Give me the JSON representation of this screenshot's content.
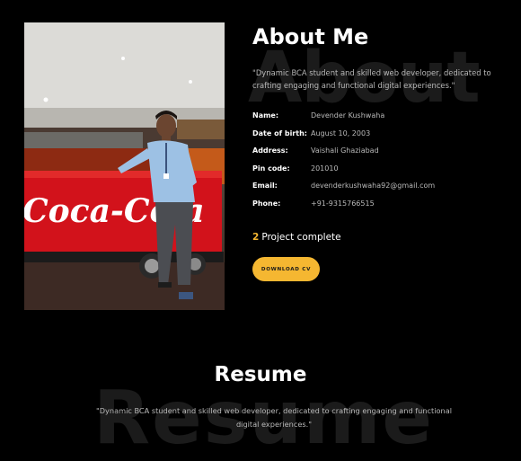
{
  "about": {
    "bg_text": "About",
    "title": "About Me",
    "description": "\"Dynamic BCA student and skilled web developer, dedicated to crafting engaging and functional digital experiences.\"",
    "photo_brand_text": "Coca-Cola",
    "info": [
      {
        "label": "Name:",
        "value": "Devender Kushwaha"
      },
      {
        "label": "Date of birth:",
        "value": "August 10, 2003"
      },
      {
        "label": "Address:",
        "value": "Vaishali Ghaziabad"
      },
      {
        "label": "Pin code:",
        "value": "201010"
      },
      {
        "label": "Email:",
        "value": "devenderkushwaha92@gmail.com"
      },
      {
        "label": "Phone:",
        "value": "+91-9315766515"
      }
    ],
    "projects_count": "2",
    "projects_label": "Project complete",
    "download_label": "DOWNLOAD CV"
  },
  "resume": {
    "bg_text": "Resume",
    "title": "Resume",
    "description": "\"Dynamic BCA student and skilled web developer, dedicated to crafting engaging and functional digital experiences.\""
  },
  "colors": {
    "accent": "#f5b731",
    "background": "#000000",
    "muted_text": "#b9b9b9"
  }
}
